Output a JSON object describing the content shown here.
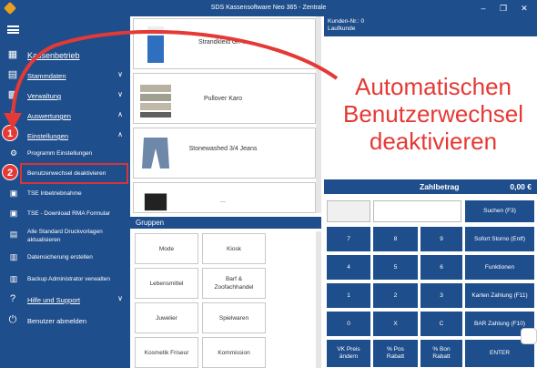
{
  "window": {
    "title": "SDS Kassensoftware Neo 365 - Zentrale",
    "controls": [
      "–",
      "❐",
      "✕"
    ]
  },
  "sidebar": {
    "items": [
      {
        "label": "Kassenbetrieb",
        "icon": "register-icon"
      },
      {
        "label": "Stammdaten",
        "icon": "database-icon"
      },
      {
        "label": "Verwaltung",
        "icon": "admin-icon"
      },
      {
        "label": "Auswertungen",
        "icon": "chart-icon"
      },
      {
        "label": "Einstellungen",
        "icon": "settings-icon"
      }
    ],
    "subitems": [
      {
        "label": "Programm Einstellungen",
        "icon": "gear-icon"
      },
      {
        "label": "Benutzerwechsel deaktivieren",
        "icon": "user-switch-icon"
      },
      {
        "label": "TSE Inbetriebnahme",
        "icon": "tse-icon"
      },
      {
        "label": "TSE - Download RMA Formular",
        "icon": "tse-download-icon"
      },
      {
        "label": "Alle Standard Druckvorlagen aktualisieren",
        "icon": "print-icon"
      },
      {
        "label": "Datensicherung erstellen",
        "icon": "backup-icon"
      },
      {
        "label": "Backup Administrator verwalten",
        "icon": "backup-admin-icon"
      }
    ],
    "help": {
      "label": "Hilfe und Support"
    },
    "logout": {
      "label": "Benutzer abmelden"
    }
  },
  "annotations": {
    "badge1": "1",
    "badge2": "2",
    "callout": "Automatischen Benutzerwechsel deaktivieren",
    "accent": "#e53935"
  },
  "products": [
    {
      "name": "Strandkleid Gr. ..."
    },
    {
      "name": "Pullover Karo"
    },
    {
      "name": "Stonewashed 3/4 Jeans"
    },
    {
      "name": "..."
    }
  ],
  "groups": {
    "title": "Gruppen",
    "items": [
      "Mode",
      "Kiosk",
      "Lebensmittel",
      "Barf & Zoofachhandel",
      "Juwelier",
      "Spielwaren",
      "Kosmetik Friseur",
      "Kommission"
    ]
  },
  "customer": {
    "number_label": "Kunden-Nr.: 0",
    "name": "Laufkunde"
  },
  "payment": {
    "label": "Zahlbetrag",
    "amount": "0,00 €"
  },
  "keypad": {
    "search": "Suchen (F3)",
    "keys": [
      "7",
      "8",
      "9",
      "4",
      "5",
      "6",
      "1",
      "2",
      "3",
      "0",
      "X",
      "C"
    ],
    "functions": [
      "Sofort Storno (Entf)",
      "Funktionen",
      "Karten Zahlung (F11)",
      "BAR Zahlung (F10)"
    ],
    "bottom": [
      "VK Preis ändern",
      "% Pos Rabatt",
      "% Bon Rabatt",
      "ENTER"
    ]
  },
  "colors": {
    "primary": "#1f4e8c",
    "accent": "#e53935"
  }
}
